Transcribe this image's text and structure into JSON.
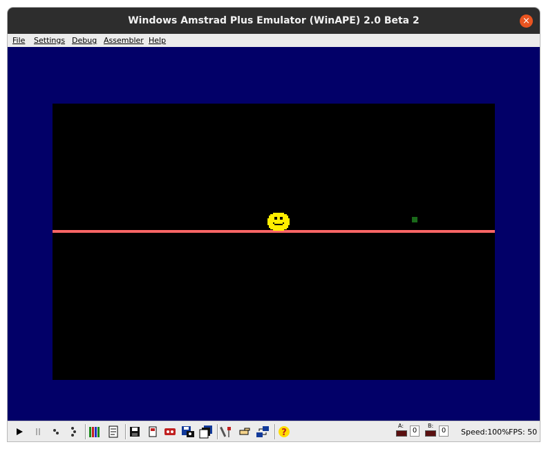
{
  "window": {
    "title": "Windows Amstrad Plus Emulator (WinAPE) 2.0 Beta 2",
    "close_glyph": "×"
  },
  "menu": [
    {
      "label": "File"
    },
    {
      "label": "Settings"
    },
    {
      "label": "Debug"
    },
    {
      "label": "Assembler"
    },
    {
      "label": "Help"
    }
  ],
  "colors": {
    "border": "#020068",
    "screen": "#000000",
    "floor_line": "#ff6666",
    "sprite": "#ffee00",
    "pickup": "#1a6a1a"
  },
  "toolbar": {
    "icons": [
      "play-icon",
      "pause-icon",
      "step-icon",
      "step-over-icon",
      "roms-icon",
      "tape-doc-icon",
      "save-disk-icon",
      "sd-card-icon",
      "tape-icon",
      "snapshot-disk-icon",
      "multi-disk-icon",
      "tools-icon",
      "pointer-icon",
      "network-icon",
      "help-icon"
    ],
    "drive_a": {
      "label": "A:",
      "value": "0"
    },
    "drive_b": {
      "label": "B:",
      "value": "0"
    },
    "help_glyph": "?"
  },
  "status": {
    "speed": "Speed:100%",
    "fps": "FPS: 50"
  }
}
